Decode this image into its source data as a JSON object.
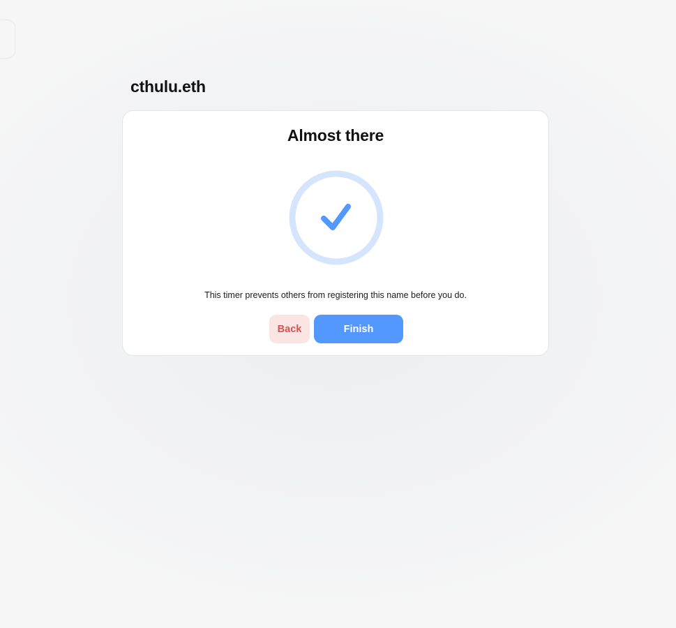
{
  "header": {
    "name": "cthulu.eth"
  },
  "card": {
    "title": "Almost there",
    "progress": {
      "icon": "checkmark-icon",
      "state": "complete",
      "fraction": 1.0
    },
    "description": "This timer prevents others from registering this name before you do.",
    "buttons": {
      "back_label": "Back",
      "finish_label": "Finish"
    }
  },
  "colors": {
    "accent": "#5298ff",
    "ring": "#d5e5fd",
    "danger_text": "#d9534f",
    "danger_bg": "#fae4e4"
  }
}
